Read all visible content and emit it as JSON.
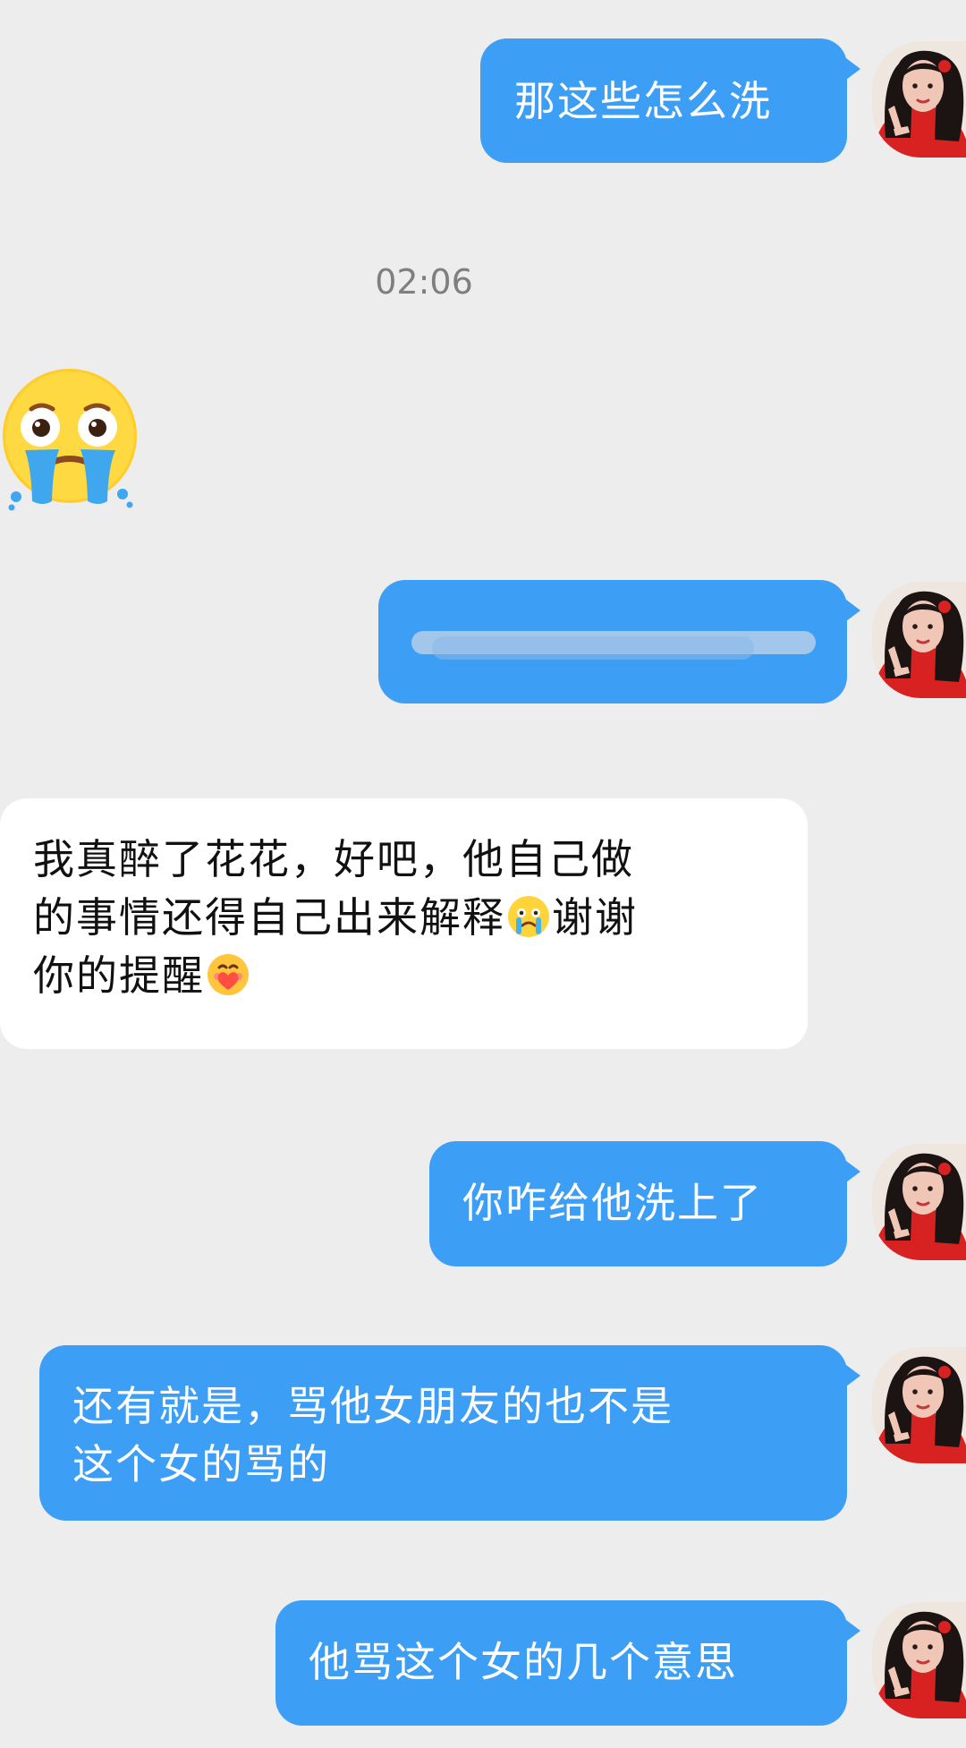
{
  "messages": [
    {
      "side": "right",
      "text": "那这些怎么洗"
    },
    {
      "side": "left",
      "kind": "sticker",
      "sticker": "crying-face"
    },
    {
      "side": "right",
      "kind": "blurred"
    },
    {
      "side": "left",
      "line1": "我真醉了花花，好吧，他自己做",
      "line2a": "的事情还得自己出来解释",
      "line2b": "谢谢",
      "line3": "你的提醒",
      "emojis": [
        "crying-emoji",
        "heart-hug-emoji"
      ]
    },
    {
      "side": "right",
      "text": "你咋给他洗上了"
    },
    {
      "side": "right",
      "line1": "还有就是，骂他女朋友的也不是",
      "line2": "这个女的骂的"
    },
    {
      "side": "right",
      "text": "他骂这个女的几个意思"
    }
  ],
  "timestamp": "02:06",
  "colors": {
    "background": "#ededed",
    "sent_bubble": "#3d9ef6",
    "received_bubble": "#ffffff",
    "timestamp": "#7f7f7f"
  },
  "icons": {
    "avatar": "profile-avatar",
    "sticker": "crying-face-sticker"
  }
}
